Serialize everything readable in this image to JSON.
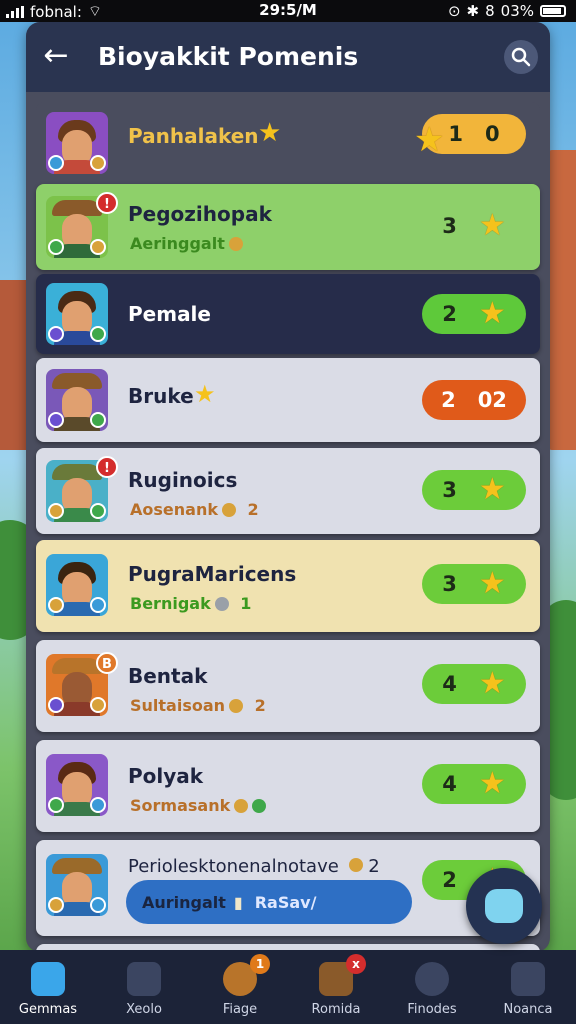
{
  "status": {
    "carrier": "fobnal:",
    "time": "29:5/M",
    "battery": "03%",
    "bt_label": "8"
  },
  "header": {
    "title": "Bioyakkit Pomenis",
    "back_label": "←"
  },
  "rows": [
    {
      "name": "Panhalaken",
      "score": "1",
      "score2": "0",
      "pill_color": "#f2b53a",
      "bg": "#4a4d5e",
      "name_color": "#f0c24a"
    },
    {
      "name": "Pegozihopak",
      "sub": "Aeringgalt",
      "score": "3",
      "pill_color": "transparent",
      "bg": "#8ed06a",
      "sub_color": "#3b8a1f"
    },
    {
      "name": "Pemale",
      "score": "2",
      "pill_color": "#5ec93a",
      "bg": "#262c4a",
      "name_color": "#ffffff"
    },
    {
      "name": "Bruke",
      "score": "2",
      "score2": "02",
      "pill_color": "#e05a1a",
      "bg": "#dadce6"
    },
    {
      "name": "Ruginoics",
      "sub": "Aosenank",
      "sub_num": "2",
      "score": "3",
      "pill_color": "#6ccc3a",
      "bg": "#dadce6",
      "sub_color": "#b8702a"
    },
    {
      "name": "PugraMaricens",
      "sub": "Bernigak",
      "sub_num": "1",
      "score": "3",
      "pill_color": "#6ccc3a",
      "bg": "#f0e2b0",
      "sub_color": "#3b9a1f"
    },
    {
      "name": "Bentak",
      "sub": "Sultaisoan",
      "sub_num": "2",
      "score": "4",
      "pill_color": "#6ccc3a",
      "bg": "#dadce6",
      "sub_color": "#b8702a"
    },
    {
      "name": "Polyak",
      "sub": "Sormasank",
      "score": "4",
      "pill_color": "#6ccc3a",
      "bg": "#dadce6",
      "sub_color": "#b8702a"
    },
    {
      "name": "Periolesktonenalnotave",
      "name_num": "2",
      "score": "2",
      "pill_color": "#6ccc3a",
      "bg": "#dadce6"
    }
  ],
  "toast": {
    "left": "Auringalt",
    "right": "RaSav/"
  },
  "nav": [
    {
      "label": "Gemmas",
      "active": true
    },
    {
      "label": "Xeolo"
    },
    {
      "label": "Fiage",
      "badge": "1"
    },
    {
      "label": "Romida",
      "badge": "x"
    },
    {
      "label": "Finodes"
    },
    {
      "label": "Noanca"
    }
  ],
  "colors": {
    "panel": "#4a4d5e",
    "header": "#2a3450",
    "nav": "#1c2338",
    "star": "#f5c21c"
  }
}
